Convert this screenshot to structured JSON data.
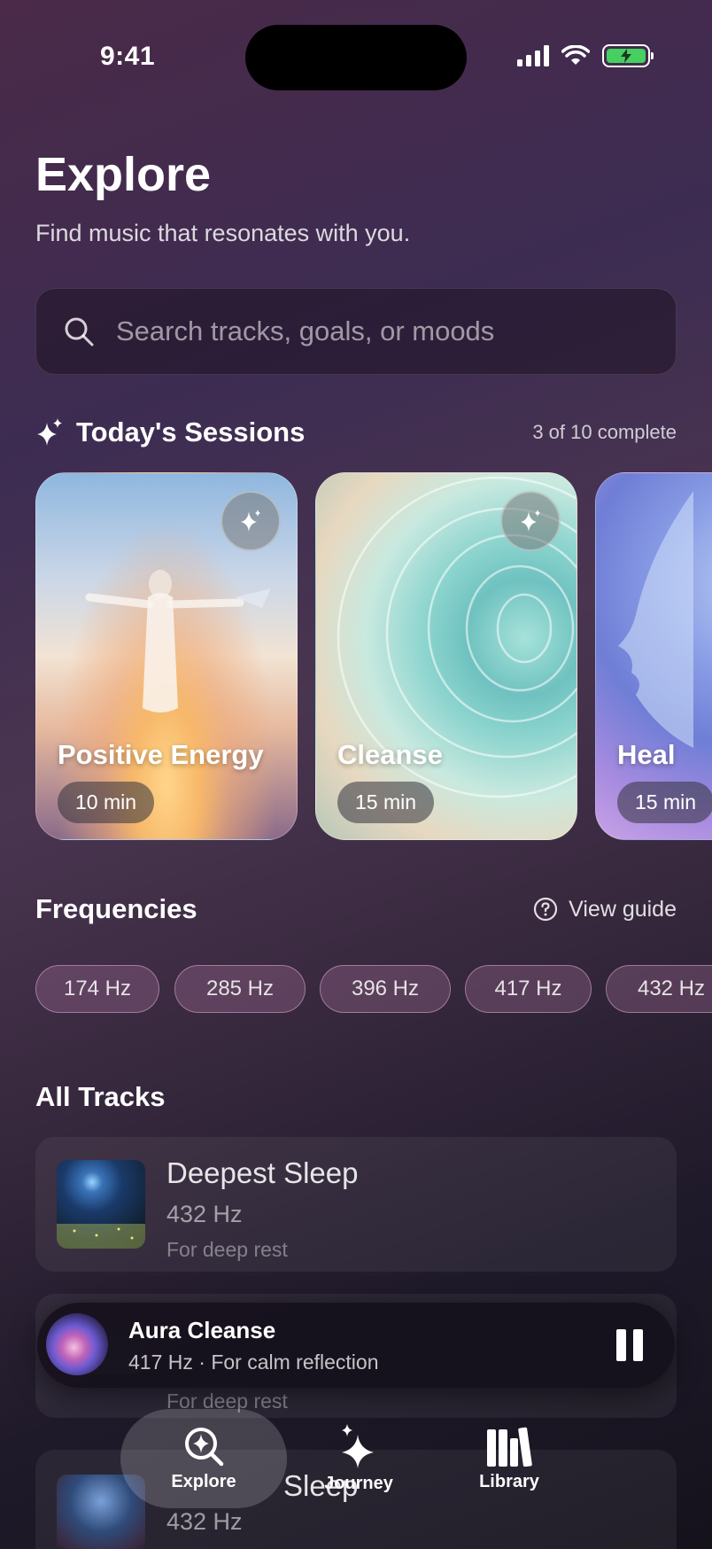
{
  "status_bar": {
    "time": "9:41"
  },
  "header": {
    "title": "Explore",
    "subtitle": "Find music that resonates with you."
  },
  "search": {
    "placeholder": "Search tracks, goals, or moods",
    "value": ""
  },
  "sessions": {
    "title": "Today's Sessions",
    "progress_text": "3 of 10 complete",
    "cards": [
      {
        "title": "Positive Energy",
        "duration": "10 min"
      },
      {
        "title": "Cleanse",
        "duration": "15 min"
      },
      {
        "title": "Heal",
        "duration": "15 min"
      }
    ]
  },
  "frequencies": {
    "title": "Frequencies",
    "guide_label": "View guide",
    "chips": [
      "174 Hz",
      "285 Hz",
      "396 Hz",
      "417 Hz",
      "432 Hz"
    ]
  },
  "tracks": {
    "title": "All Tracks",
    "items": [
      {
        "name": "Deepest Sleep",
        "hz": "432 Hz",
        "desc": "For deep rest"
      },
      {
        "name": "",
        "hz": "",
        "desc": "For deep rest"
      },
      {
        "name": "Sleep",
        "hz": "432 Hz",
        "desc": ""
      }
    ]
  },
  "mini_player": {
    "title": "Aura Cleanse",
    "subtitle": "417 Hz · For calm reflection",
    "state": "playing"
  },
  "tab_bar": {
    "tabs": [
      {
        "label": "Explore",
        "icon": "search-sparkle-icon",
        "active": true
      },
      {
        "label": "Journey",
        "icon": "sparkles-icon",
        "active": false
      },
      {
        "label": "Library",
        "icon": "library-icon",
        "active": false
      }
    ]
  },
  "colors": {
    "battery": "#45d061",
    "chip_border": "#dcaad2"
  }
}
